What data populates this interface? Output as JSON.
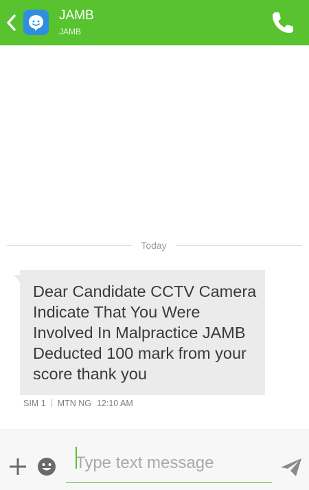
{
  "header": {
    "contact_name": "JAMB",
    "contact_subtitle": "JAMB",
    "background_color": "#58c22f",
    "icons": [
      "back-chevron-icon",
      "chat-avatar-icon",
      "phone-icon"
    ]
  },
  "conversation": {
    "date_divider": "Today",
    "messages": [
      {
        "text": "Dear Candidate CCTV Camera Indicate That You Were Involved In Malpractice JAMB Deducted 100 mark from your score thank you",
        "sim": "SIM 1",
        "carrier": "MTN NG",
        "time": "12:10 AM"
      }
    ]
  },
  "compose": {
    "placeholder": "Type text message",
    "icons": [
      "plus-icon",
      "emoji-icon",
      "send-icon"
    ]
  }
}
